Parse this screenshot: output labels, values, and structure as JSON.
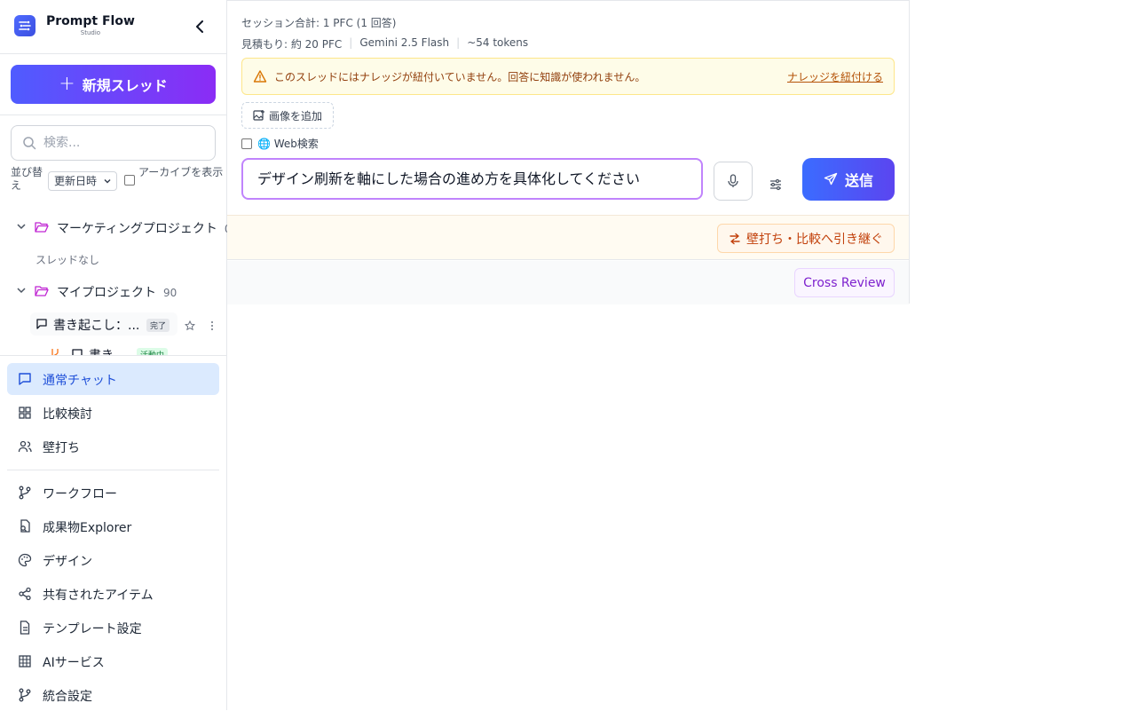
{
  "brand": {
    "title": "Prompt Flow",
    "subtitle": "Studio"
  },
  "sidebar": {
    "new_thread_label": "新規スレッド",
    "search_placeholder": "検索...",
    "sort_label": "並び替え",
    "sort_value": "更新日時",
    "archive_label": "アーカイブを表示",
    "projects": [
      {
        "name": "マーケティングプロジェクト",
        "count": "0",
        "empty_note": "スレッドなし"
      },
      {
        "name": "マイプロジェクト",
        "count": "90"
      }
    ],
    "threads": [
      {
        "name": "書き起こし：...",
        "badge": "完了"
      },
      {
        "name": "書き...",
        "badge": "活動中"
      }
    ],
    "modes": [
      {
        "label": "通常チャット",
        "icon": "chat-icon",
        "active": true
      },
      {
        "label": "比較検討",
        "icon": "grid-icon",
        "active": false
      },
      {
        "label": "壁打ち",
        "icon": "users-icon",
        "active": false
      }
    ],
    "tools": [
      {
        "label": "ワークフロー",
        "icon": "branch-icon"
      },
      {
        "label": "成果物Explorer",
        "icon": "file-search-icon"
      },
      {
        "label": "デザイン",
        "icon": "palette-icon"
      },
      {
        "label": "共有されたアイテム",
        "icon": "share-icon"
      },
      {
        "label": "テンプレート設定",
        "icon": "document-icon"
      },
      {
        "label": "AIサービス",
        "icon": "table-icon"
      },
      {
        "label": "統合設定",
        "icon": "branch-icon"
      }
    ]
  },
  "main": {
    "session_total": "セッション合計: 1 PFC (1 回答)",
    "estimate": "見積もり: 約 20 PFC",
    "model": "Gemini 2.5 Flash",
    "tokens": "~54 tokens",
    "warning_text": "このスレッドにはナレッジが紐付いていません。回答に知識が使われません。",
    "warning_link": "ナレッジを紐付ける",
    "add_image_label": "画像を追加",
    "web_search_label": "🌐 Web検索",
    "composer_value": "デザイン刷新を軸にした場合の進め方を具体化してください",
    "send_label": "送信",
    "handoff_label": "壁打ち・比較へ引き継ぐ",
    "cross_review_label": "Cross Review"
  },
  "colors": {
    "accent": "#4f5cff",
    "active_nav_bg": "#dbeafe",
    "warning_bg": "#fefce8",
    "composer_border": "#c084fc"
  }
}
